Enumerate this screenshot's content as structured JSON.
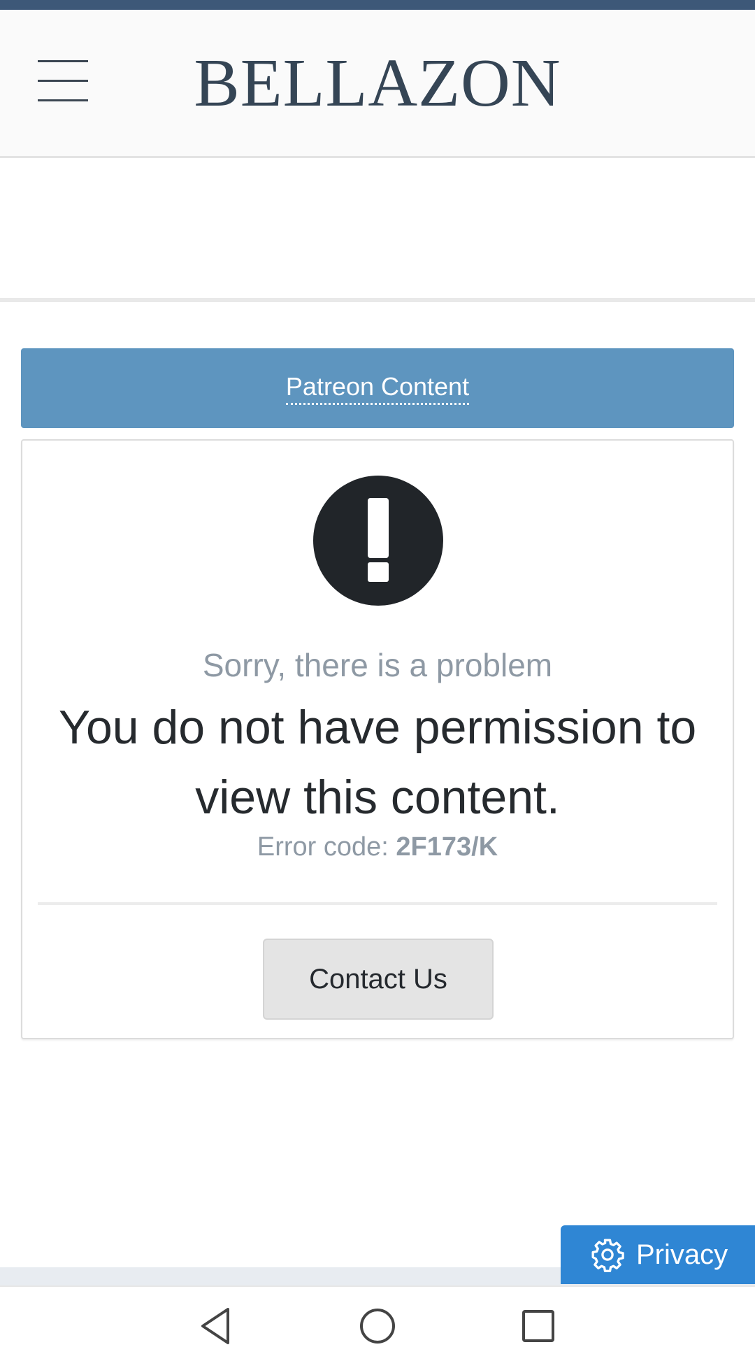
{
  "header": {
    "logo_text": "BELLAZON",
    "menu_icon": "hamburger-menu-icon"
  },
  "section": {
    "title": "Patreon Content"
  },
  "error": {
    "icon": "exclamation-circle-icon",
    "subtitle": "Sorry, there is a problem",
    "message": "You do not have permission to view this content.",
    "code_label": "Error code: ",
    "code_value": "2F173/K",
    "contact_label": "Contact Us"
  },
  "privacy": {
    "icon": "gear-icon",
    "label": "Privacy"
  },
  "system_nav": {
    "back_icon": "back-triangle-icon",
    "home_icon": "home-circle-icon",
    "recents_icon": "recents-square-icon"
  },
  "colors": {
    "top_strip": "#3d5878",
    "section_bar": "#5e95bf",
    "privacy_button": "#2f86d4",
    "logo": "#354555",
    "subtle_text": "#8e99a4"
  }
}
